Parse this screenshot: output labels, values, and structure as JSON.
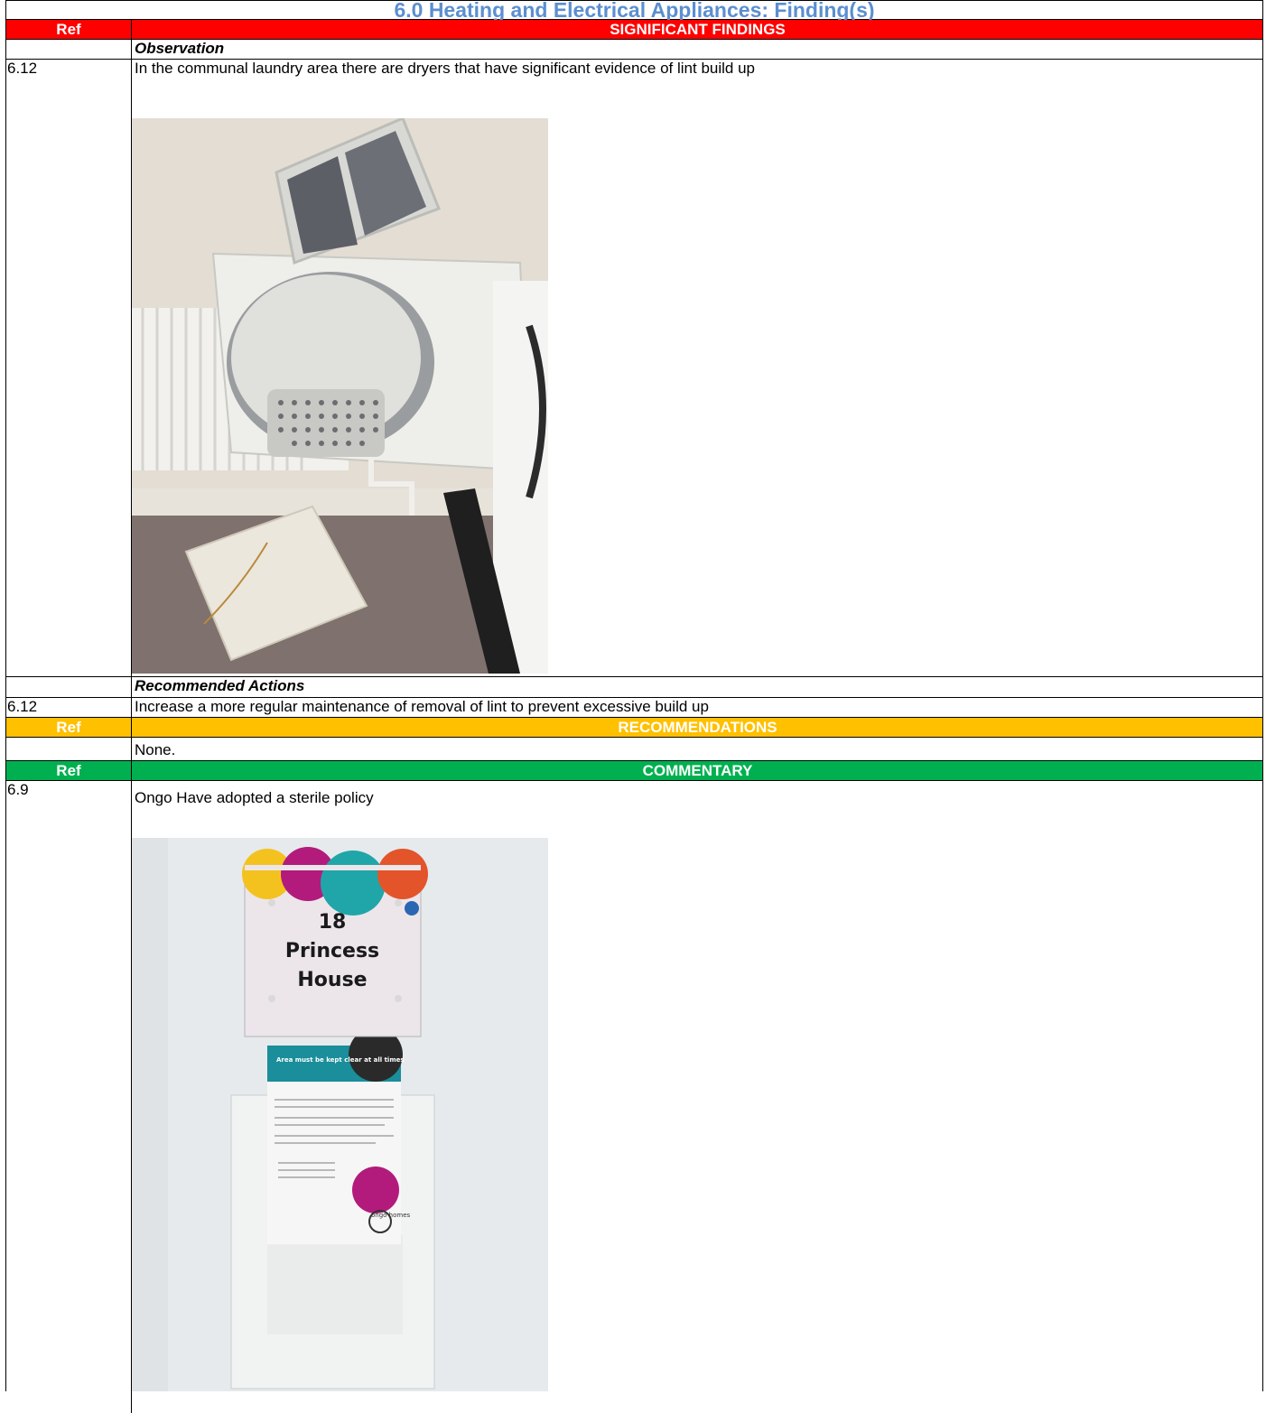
{
  "title": "6.0 Heating and Electrical Appliances: Finding(s)",
  "sections": {
    "significant": {
      "ref_label": "Ref",
      "heading": "SIGNIFICANT FINDINGS",
      "color": "#ff0000"
    },
    "recommendations": {
      "ref_label": "Ref",
      "heading": "RECOMMENDATIONS",
      "color": "#ffc000"
    },
    "commentary": {
      "ref_label": "Ref",
      "heading": "COMMENTARY",
      "color": "#00b050"
    }
  },
  "observation": {
    "label": "Observation",
    "ref": "6.12",
    "text": "In the communal laundry area there are dryers that have significant evidence  of lint build up"
  },
  "recommended_actions": {
    "label": "Recommended Actions",
    "ref": "6.12",
    "text": "Increase a more regular maintenance of removal of lint to prevent excessive build up"
  },
  "recommendations_text": "None.",
  "commentary_item": {
    "ref": "6.9",
    "text": "Ongo Have adopted a sterile policy"
  },
  "photo2_sign": {
    "line1": "18",
    "line2": "Princess",
    "line3": "House",
    "poster_heading": "Area must be kept clear at all times",
    "poster_logo": "ongo homes"
  },
  "colors": {
    "title": "#5b8fd0"
  }
}
